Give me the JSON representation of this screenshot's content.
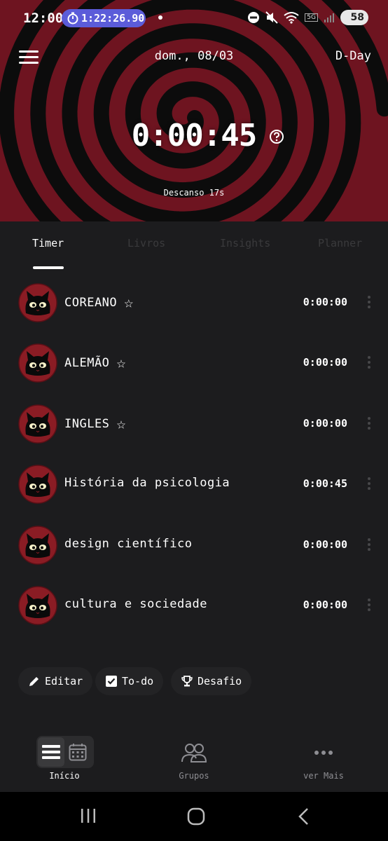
{
  "status_bar": {
    "time": "12:00",
    "stopwatch": "1:22:26.90",
    "network": "5G",
    "battery": "58"
  },
  "header": {
    "date": "dom., 08/03",
    "dday": "D-Day",
    "timer": "0:00:45",
    "rest": "Descanso 17s"
  },
  "tabs": [
    {
      "label": "Timer",
      "active": true
    },
    {
      "label": "Livros",
      "active": false
    },
    {
      "label": "Insights",
      "active": false
    },
    {
      "label": "Planner",
      "active": false
    }
  ],
  "subjects": [
    {
      "name": "COREANO",
      "time": "0:00:00",
      "starred": true
    },
    {
      "name": "ALEMÃO",
      "time": "0:00:00",
      "starred": true
    },
    {
      "name": "INGLES",
      "time": "0:00:00",
      "starred": true
    },
    {
      "name": "História da psicologia",
      "time": "0:00:45",
      "starred": false
    },
    {
      "name": "design científico",
      "time": "0:00:00",
      "starred": false
    },
    {
      "name": "cultura e sociedade",
      "time": "0:00:00",
      "starred": false
    }
  ],
  "actions": {
    "edit": "Editar",
    "todo": "To-do",
    "challenge": "Desafio"
  },
  "bottom_nav": {
    "home": "Início",
    "groups": "Grupos",
    "more": "ver Mais"
  },
  "colors": {
    "spiral_red": "#6e1420",
    "spiral_black": "#0c0c0c",
    "background": "#1c1c1e",
    "stopwatch_pill": "#5b5cd9"
  }
}
